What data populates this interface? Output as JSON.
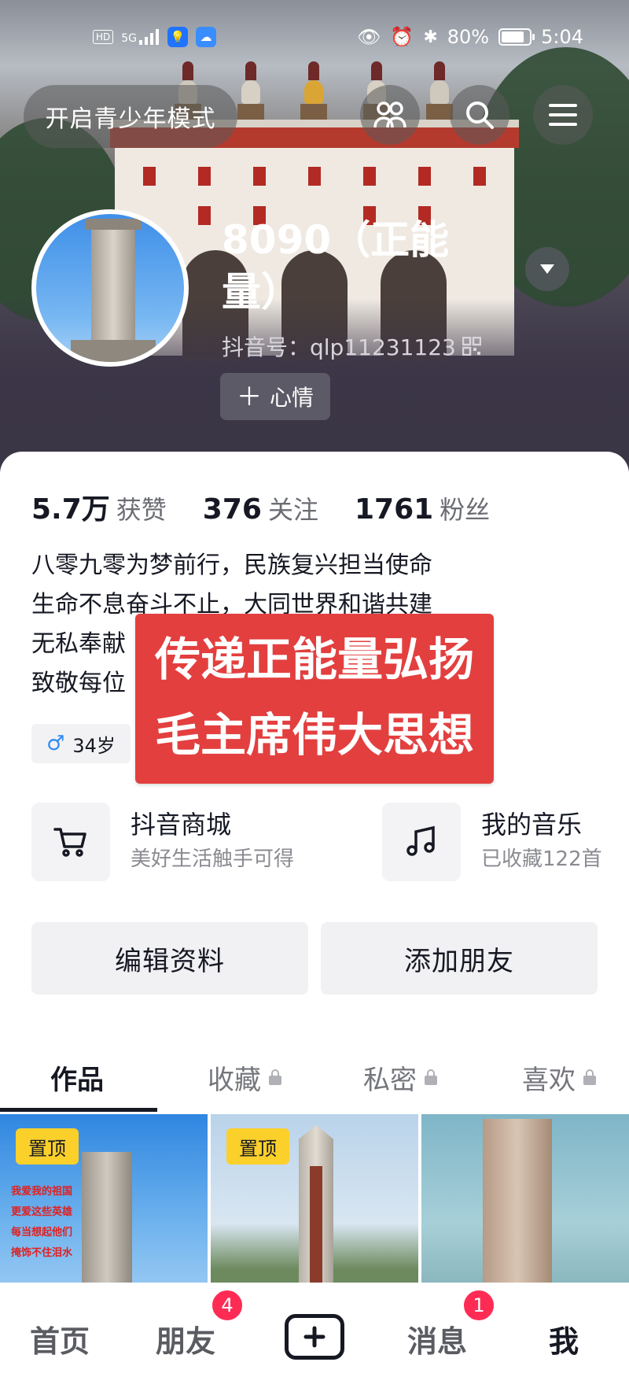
{
  "status_bar": {
    "hd_label": "HD",
    "signal_label": "5G",
    "battery": "80%",
    "time": "5:04"
  },
  "header": {
    "teen_mode_label": "开启青少年模式",
    "nickname": "8090（正能量）",
    "douyin_id": "抖音号：qlp11231123",
    "mood_label": "心情"
  },
  "stats": [
    {
      "value": "5.7万",
      "label": "获赞"
    },
    {
      "value": "376",
      "label": "关注"
    },
    {
      "value": "1761",
      "label": "粉丝"
    }
  ],
  "bio_lines": [
    "八零九零为梦前行，民族复兴担当使命",
    "生命不息奋斗不止，大同世界和谐共建",
    "无私奉献",
    "致敬每位"
  ],
  "overlay_lines": [
    "传递正能量弘扬",
    "毛主席伟大思想"
  ],
  "age_label": "34岁",
  "services": [
    {
      "title": "抖音商城",
      "subtitle": "美好生活触手可得",
      "icon": "cart-icon"
    },
    {
      "title": "我的音乐",
      "subtitle": "已收藏122首",
      "icon": "music-note-icon"
    }
  ],
  "actions": {
    "edit_profile": "编辑资料",
    "add_friend": "添加朋友"
  },
  "tabs": [
    {
      "label": "作品",
      "active": true,
      "locked": false
    },
    {
      "label": "收藏",
      "active": false,
      "locked": true
    },
    {
      "label": "私密",
      "active": false,
      "locked": true
    },
    {
      "label": "喜欢",
      "active": false,
      "locked": true
    }
  ],
  "grid": {
    "pin_label": "置顶",
    "thumb1_caption": [
      "我爱我的祖国",
      "更爱这些英雄",
      "每当想起他们",
      "掩饰不住泪水"
    ]
  },
  "bottom_nav": {
    "home": "首页",
    "friends": "朋友",
    "friends_badge": "4",
    "messages": "消息",
    "messages_badge": "1",
    "me": "我"
  },
  "colors": {
    "accent_red": "#fe2c55",
    "overlay_red": "#e33f3f",
    "pin_yellow": "#fbd02b"
  }
}
